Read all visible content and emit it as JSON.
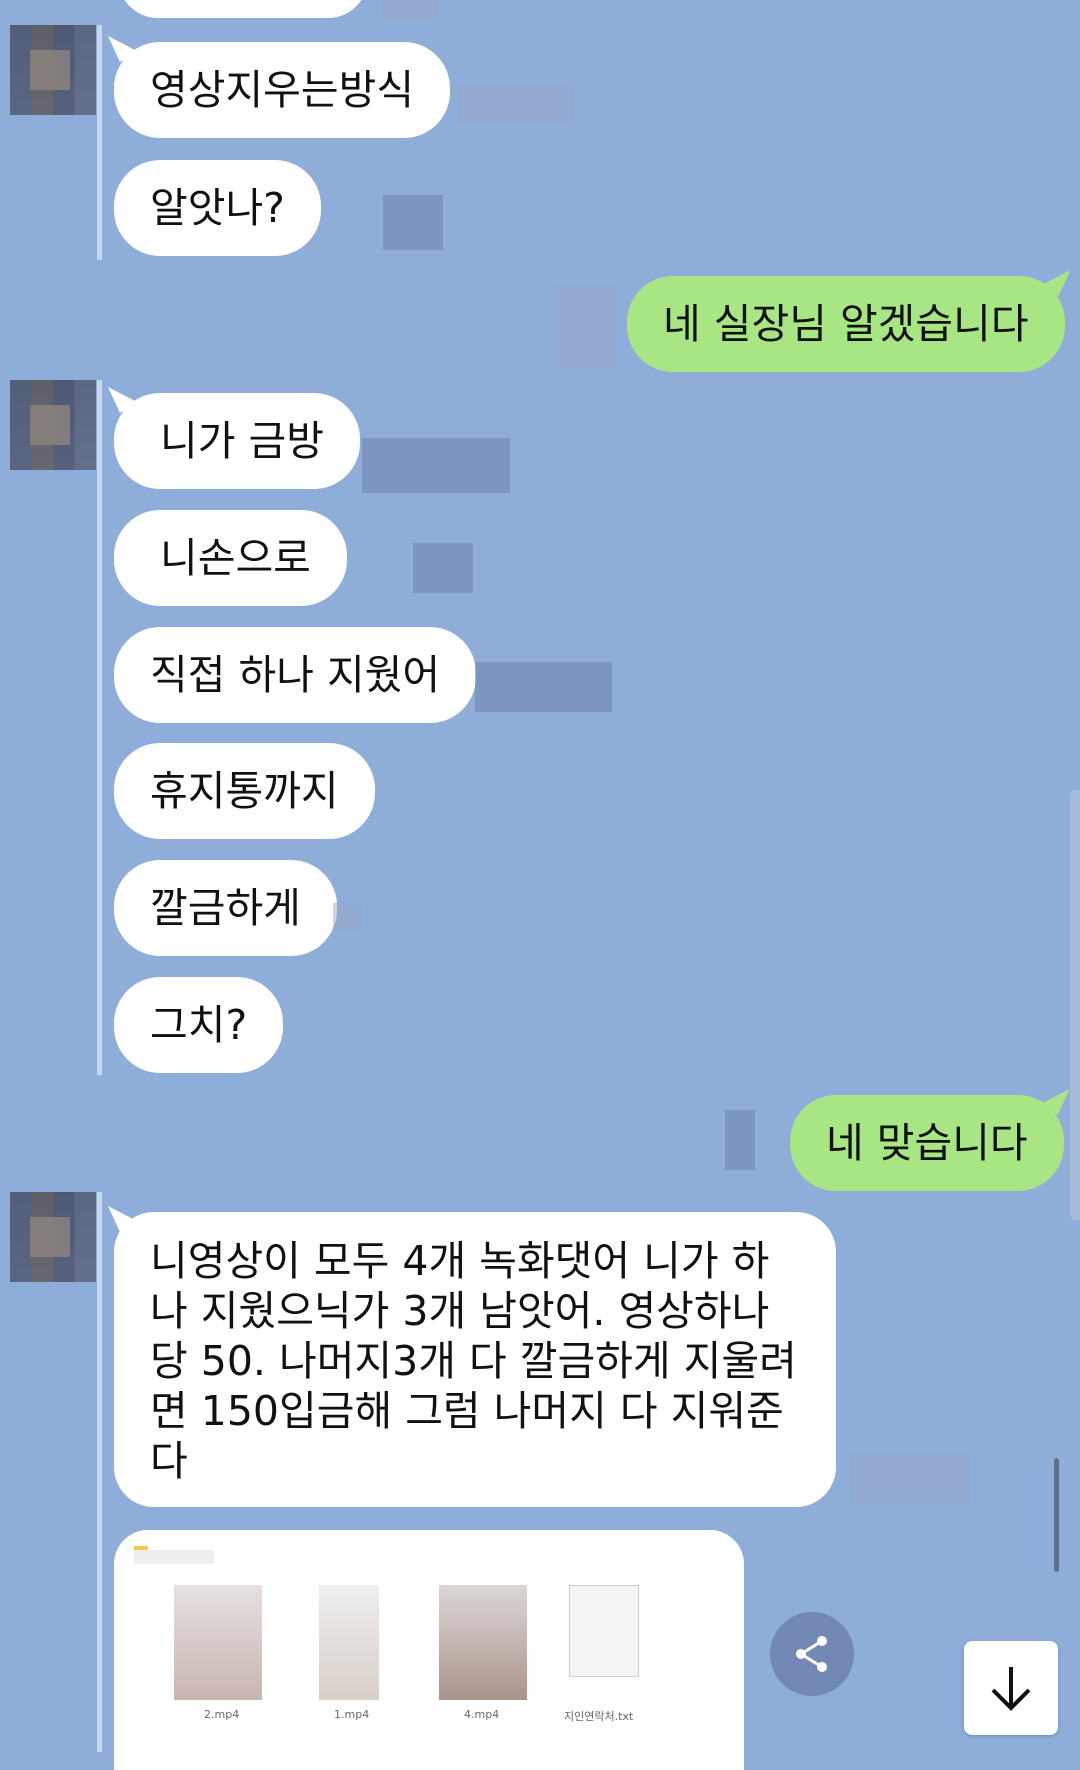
{
  "messages": {
    "m1": "영상지우는방식",
    "m2": "알앗나?",
    "m3": "네 실장님 알겠습니다",
    "m4": "니가 금방",
    "m5": "니손으로",
    "m6": "직접 하나 지웠어",
    "m7": "휴지통까지",
    "m8": "깔금하게",
    "m9": "그치?",
    "m10": "네 맞습니다",
    "m11": "니영상이 모두 4개 녹화댓어 니가 하나 지웠으닉가 3개 남앗어. 영상하나당 50. 나머지3개 다 깔금하게 지울려면 150입금해 그럼 나머지 다 지워준다"
  },
  "attachment": {
    "files": [
      "2.mp4",
      "1.mp4",
      "4.mp4",
      "지인연락처.txt"
    ]
  },
  "icons": {
    "share": "share-icon",
    "scroll_down": "arrow-down-icon"
  },
  "colors": {
    "background": "#8fadd9",
    "incoming_bubble": "#ffffff",
    "outgoing_bubble": "#a8e684"
  }
}
